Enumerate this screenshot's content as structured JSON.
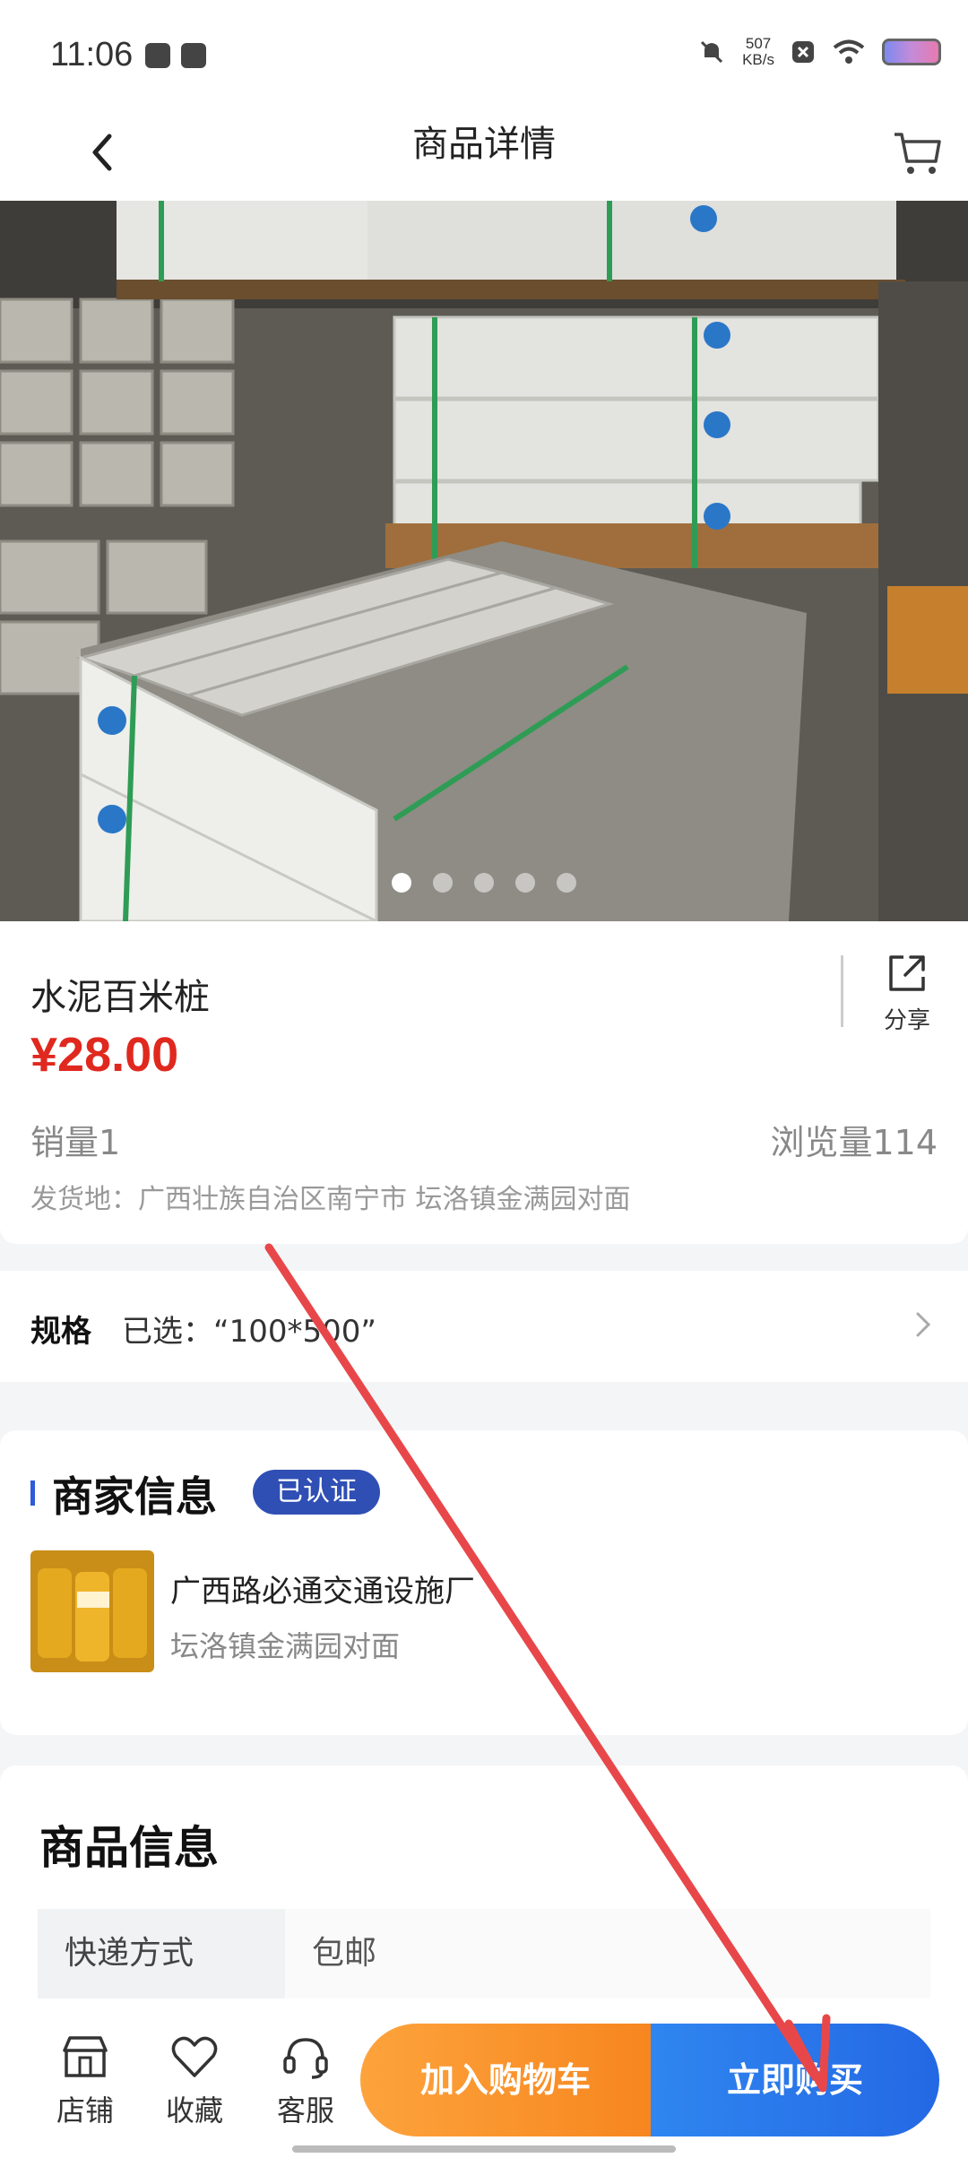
{
  "status_bar": {
    "time": "11:06",
    "net_speed_value": "507",
    "net_speed_unit": "KB/s"
  },
  "header": {
    "title": "商品详情"
  },
  "gallery": {
    "image_count": 5,
    "active_index": 0
  },
  "product": {
    "name": "水泥百米桩",
    "price": "¥28.00",
    "sales": "销量1",
    "views": "浏览量114",
    "ship_from": "发货地：广西壮族自治区南宁市 坛洛镇金满园对面",
    "share_label": "分享"
  },
  "spec": {
    "label": "规格",
    "selected": "已选：“100*500”"
  },
  "merchant": {
    "section_title": "商家信息",
    "badge": "已认证",
    "name": "广西路必通交通设施厂",
    "address": "坛洛镇金满园对面"
  },
  "product_info": {
    "section_title": "商品信息",
    "rows": [
      {
        "key": "快递方式",
        "value": "包邮"
      }
    ]
  },
  "bottom_bar": {
    "tabs": [
      {
        "label": "店铺",
        "icon": "shop-icon"
      },
      {
        "label": "收藏",
        "icon": "heart-icon"
      },
      {
        "label": "客服",
        "icon": "headset-icon"
      }
    ],
    "add_to_cart": "加入购物车",
    "buy_now": "立即购买"
  },
  "colors": {
    "price": "#e0281f",
    "badge": "#2f4fb4",
    "cart_button": "#f7861f",
    "buy_button": "#2468e4",
    "annotation_arrow": "#e8474a"
  }
}
